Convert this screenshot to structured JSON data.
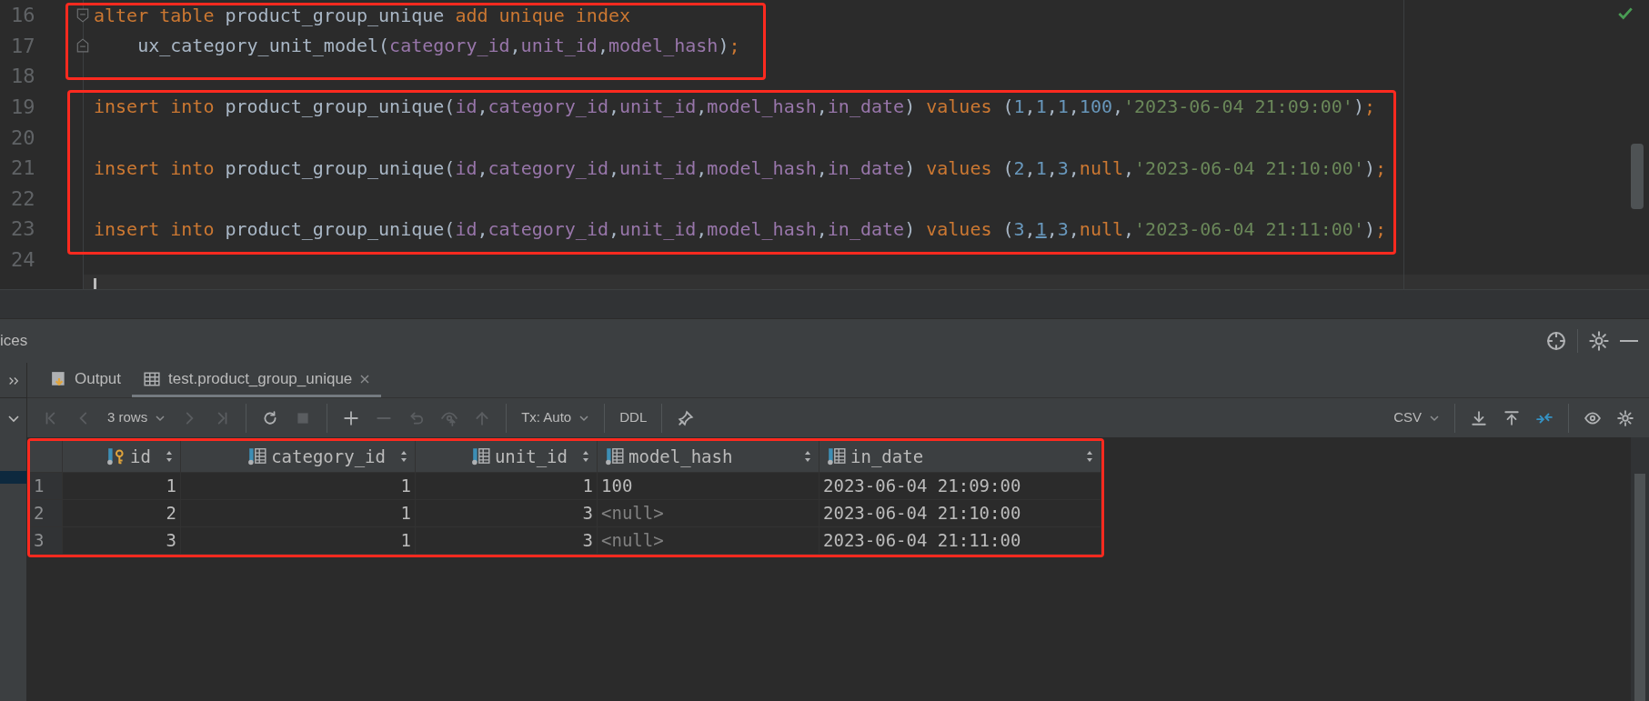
{
  "editor": {
    "lines": [
      {
        "number": "16",
        "fold_start": true,
        "fold_end": false,
        "tokens": [
          {
            "kind": "kw",
            "text": "alter table "
          },
          {
            "kind": "id",
            "text": "product_group_unique "
          },
          {
            "kind": "kw",
            "text": "add unique index"
          }
        ]
      },
      {
        "number": "17",
        "fold_start": false,
        "fold_end": true,
        "tokens": [
          {
            "kind": "id",
            "text": "    ux_category_unit_model("
          },
          {
            "kind": "col",
            "text": "category_id"
          },
          {
            "kind": "id",
            "text": ","
          },
          {
            "kind": "col",
            "text": "unit_id"
          },
          {
            "kind": "id",
            "text": ","
          },
          {
            "kind": "col",
            "text": "model_hash"
          },
          {
            "kind": "id",
            "text": ")"
          },
          {
            "kind": "semi",
            "text": ";"
          }
        ]
      },
      {
        "number": "18",
        "fold_start": false,
        "fold_end": false
      },
      {
        "number": "19",
        "fold_start": false,
        "fold_end": false,
        "tokens": [
          {
            "kind": "kw",
            "text": "insert into "
          },
          {
            "kind": "id",
            "text": "product_group_unique("
          },
          {
            "kind": "col",
            "text": "id"
          },
          {
            "kind": "id",
            "text": ","
          },
          {
            "kind": "col",
            "text": "category_id"
          },
          {
            "kind": "id",
            "text": ","
          },
          {
            "kind": "col",
            "text": "unit_id"
          },
          {
            "kind": "id",
            "text": ","
          },
          {
            "kind": "col",
            "text": "model_hash"
          },
          {
            "kind": "id",
            "text": ","
          },
          {
            "kind": "col",
            "text": "in_date"
          },
          {
            "kind": "id",
            "text": ") "
          },
          {
            "kind": "kw",
            "text": "values "
          },
          {
            "kind": "id",
            "text": "("
          },
          {
            "kind": "num",
            "text": "1"
          },
          {
            "kind": "id",
            "text": ","
          },
          {
            "kind": "num",
            "text": "1"
          },
          {
            "kind": "id",
            "text": ","
          },
          {
            "kind": "num",
            "text": "1"
          },
          {
            "kind": "id",
            "text": ","
          },
          {
            "kind": "num",
            "text": "100"
          },
          {
            "kind": "id",
            "text": ","
          },
          {
            "kind": "str",
            "text": "'2023-06-04 21:09:00'"
          },
          {
            "kind": "id",
            "text": ")"
          },
          {
            "kind": "semi",
            "text": ";"
          }
        ]
      },
      {
        "number": "20",
        "fold_start": false,
        "fold_end": false
      },
      {
        "number": "21",
        "fold_start": false,
        "fold_end": false,
        "tokens": [
          {
            "kind": "kw",
            "text": "insert into "
          },
          {
            "kind": "id",
            "text": "product_group_unique("
          },
          {
            "kind": "col",
            "text": "id"
          },
          {
            "kind": "id",
            "text": ","
          },
          {
            "kind": "col",
            "text": "category_id"
          },
          {
            "kind": "id",
            "text": ","
          },
          {
            "kind": "col",
            "text": "unit_id"
          },
          {
            "kind": "id",
            "text": ","
          },
          {
            "kind": "col",
            "text": "model_hash"
          },
          {
            "kind": "id",
            "text": ","
          },
          {
            "kind": "col",
            "text": "in_date"
          },
          {
            "kind": "id",
            "text": ") "
          },
          {
            "kind": "kw",
            "text": "values "
          },
          {
            "kind": "id",
            "text": "("
          },
          {
            "kind": "num",
            "text": "2"
          },
          {
            "kind": "id",
            "text": ","
          },
          {
            "kind": "num",
            "text": "1"
          },
          {
            "kind": "id",
            "text": ","
          },
          {
            "kind": "num",
            "text": "3"
          },
          {
            "kind": "id",
            "text": ","
          },
          {
            "kind": "kw",
            "text": "null"
          },
          {
            "kind": "id",
            "text": ","
          },
          {
            "kind": "str",
            "text": "'2023-06-04 21:10:00'"
          },
          {
            "kind": "id",
            "text": ")"
          },
          {
            "kind": "semi",
            "text": ";"
          }
        ]
      },
      {
        "number": "22",
        "fold_start": false,
        "fold_end": false
      },
      {
        "number": "23",
        "fold_start": false,
        "fold_end": false,
        "tokens": [
          {
            "kind": "kw",
            "text": "insert into "
          },
          {
            "kind": "id",
            "text": "product_group_unique("
          },
          {
            "kind": "col",
            "text": "id"
          },
          {
            "kind": "id",
            "text": ","
          },
          {
            "kind": "col",
            "text": "category_id"
          },
          {
            "kind": "id",
            "text": ","
          },
          {
            "kind": "col",
            "text": "unit_id"
          },
          {
            "kind": "id",
            "text": ","
          },
          {
            "kind": "col",
            "text": "model_hash"
          },
          {
            "kind": "id",
            "text": ","
          },
          {
            "kind": "col",
            "text": "in_date"
          },
          {
            "kind": "id",
            "text": ") "
          },
          {
            "kind": "kw",
            "text": "values "
          },
          {
            "kind": "id",
            "text": "("
          },
          {
            "kind": "num",
            "text": "3"
          },
          {
            "kind": "id",
            "text": ","
          },
          {
            "kind": "numlink",
            "text": "1"
          },
          {
            "kind": "id",
            "text": ","
          },
          {
            "kind": "num",
            "text": "3"
          },
          {
            "kind": "id",
            "text": ","
          },
          {
            "kind": "kw",
            "text": "null"
          },
          {
            "kind": "id",
            "text": ","
          },
          {
            "kind": "str",
            "text": "'2023-06-04 21:11:00'"
          },
          {
            "kind": "id",
            "text": ")"
          },
          {
            "kind": "semi",
            "text": ";"
          }
        ]
      },
      {
        "number": "24",
        "fold_start": false,
        "fold_end": false
      }
    ]
  },
  "services_panel": {
    "title": "ices"
  },
  "tabs": [
    {
      "label": "Output",
      "kind": "output",
      "selected": false,
      "closable": false
    },
    {
      "label": "test.product_group_unique",
      "kind": "table",
      "selected": true,
      "closable": true
    }
  ],
  "toolbar": {
    "left_groups": [
      [
        {
          "kind": "first",
          "disabled": true
        },
        {
          "kind": "prev",
          "disabled": true
        },
        {
          "kind": "dropdown",
          "label": "3 rows",
          "disabled": false
        },
        {
          "kind": "next",
          "disabled": true
        },
        {
          "kind": "last",
          "disabled": true
        }
      ],
      [
        {
          "kind": "refresh",
          "disabled": false
        },
        {
          "kind": "stop",
          "disabled": true
        }
      ],
      [
        {
          "kind": "add",
          "disabled": false
        },
        {
          "kind": "remove",
          "disabled": true
        },
        {
          "kind": "revert",
          "disabled": true
        },
        {
          "kind": "preview",
          "disabled": true
        },
        {
          "kind": "submit",
          "disabled": true
        }
      ],
      [
        {
          "kind": "dropdown",
          "label": "Tx: Auto",
          "disabled": false
        }
      ],
      [
        {
          "kind": "text",
          "label": "DDL",
          "disabled": false
        }
      ],
      [
        {
          "kind": "pin",
          "disabled": false
        }
      ]
    ],
    "right_groups": [
      [
        {
          "kind": "dropdown",
          "label": "CSV",
          "disabled": false
        }
      ],
      [
        {
          "kind": "download",
          "disabled": false
        },
        {
          "kind": "upload",
          "disabled": false
        },
        {
          "kind": "compare",
          "disabled": false
        }
      ],
      [
        {
          "kind": "view",
          "disabled": false
        },
        {
          "kind": "settings",
          "disabled": false
        }
      ]
    ]
  },
  "table": {
    "columns": [
      {
        "label": "id",
        "key": true,
        "numeric": true
      },
      {
        "label": "category_id",
        "key": false,
        "numeric": true
      },
      {
        "label": "unit_id",
        "key": false,
        "numeric": true
      },
      {
        "label": "model_hash",
        "key": false,
        "numeric": false
      },
      {
        "label": "in_date",
        "key": false,
        "numeric": false
      }
    ],
    "rows": [
      {
        "number": "1",
        "cells": [
          {
            "text": "1",
            "null": false
          },
          {
            "text": "1",
            "null": false
          },
          {
            "text": "1",
            "null": false
          },
          {
            "text": "100",
            "null": false
          },
          {
            "text": "2023-06-04 21:09:00",
            "null": false
          }
        ]
      },
      {
        "number": "2",
        "cells": [
          {
            "text": "2",
            "null": false
          },
          {
            "text": "1",
            "null": false
          },
          {
            "text": "3",
            "null": false
          },
          {
            "text": "<null>",
            "null": true
          },
          {
            "text": "2023-06-04 21:10:00",
            "null": false
          }
        ]
      },
      {
        "number": "3",
        "cells": [
          {
            "text": "3",
            "null": false
          },
          {
            "text": "1",
            "null": false
          },
          {
            "text": "3",
            "null": false
          },
          {
            "text": "<null>",
            "null": true
          },
          {
            "text": "2023-06-04 21:11:00",
            "null": false
          }
        ]
      }
    ]
  }
}
